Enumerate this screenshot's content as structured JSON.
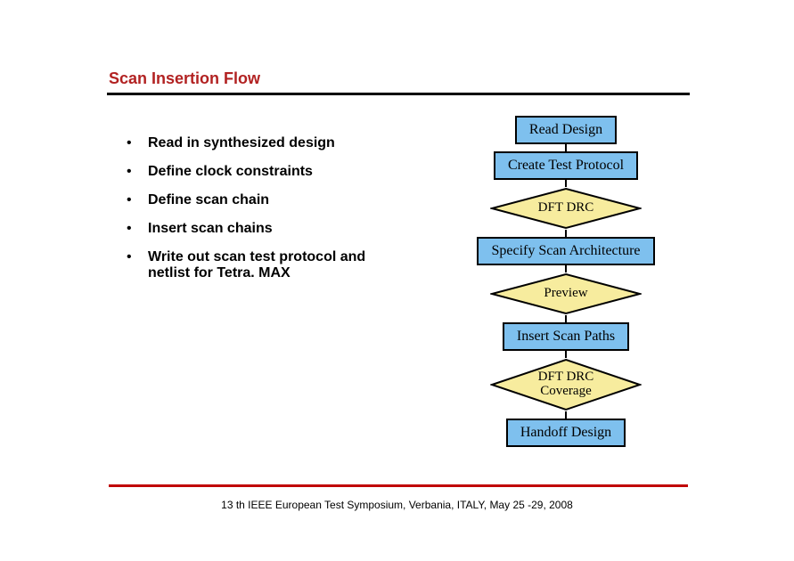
{
  "title": "Scan Insertion Flow",
  "bullets": [
    "Read in synthesized design",
    "Define clock constraints",
    "Define scan chain",
    "Insert scan chains",
    "Write out scan test protocol and netlist for Tetra. MAX"
  ],
  "flow": {
    "read_design": "Read Design",
    "create_test_protocol": "Create Test Protocol",
    "dft_drc": "DFT DRC",
    "specify_scan_arch": "Specify Scan Architecture",
    "preview": "Preview",
    "insert_scan_paths": "Insert Scan Paths",
    "dft_drc_coverage": "DFT DRC\nCoverage",
    "handoff_design": "Handoff Design"
  },
  "colors": {
    "box_fill": "#7ec0ee",
    "diamond_fill": "#f7ec9e"
  },
  "footer": "13 th IEEE European Test Symposium, Verbania, ITALY, May 25 -29, 2008"
}
